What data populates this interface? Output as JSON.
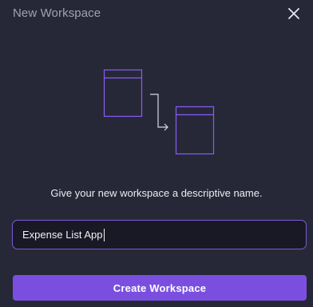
{
  "dialog": {
    "title": "New Workspace",
    "prompt": "Give your new workspace a descriptive name.",
    "name_input": {
      "value": "Expense List App",
      "placeholder": ""
    },
    "create_label": "Create Workspace",
    "icons": {
      "close": "close-icon",
      "illustration": "workspace-copy-illustration"
    }
  },
  "colors": {
    "background": "#262837",
    "accent": "#7a4fe0",
    "illustration_stroke": "#8b5cf6",
    "input_border": "#7a5ad6",
    "title_text": "#a0a2b4"
  }
}
